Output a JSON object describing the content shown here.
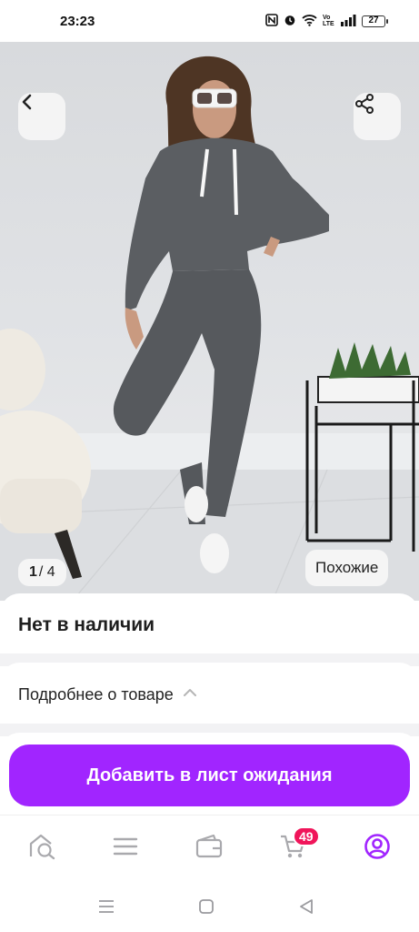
{
  "status_bar": {
    "time": "23:23",
    "icons": [
      "nfc-icon",
      "alarm-icon",
      "wifi-icon",
      "volte-icon",
      "signal-icon"
    ],
    "volte_label": "Vo LTE",
    "battery": "27"
  },
  "photo": {
    "counter_current": "1",
    "counter_total": "/ 4",
    "similar_label": "Похожие"
  },
  "product": {
    "stock_status": "Нет в наличии",
    "details_label": "Подробнее о товаре"
  },
  "action": {
    "wait_button": "Добавить в лист ожидания",
    "accent_color": "#a125ff"
  },
  "tabbar": {
    "items": [
      "home-search-icon",
      "catalog-icon",
      "wallet-icon",
      "cart-icon",
      "profile-icon"
    ],
    "cart_badge": "49",
    "active_color": "#a125ff",
    "badge_color": "#f0155a"
  },
  "navbar": {
    "items": [
      "menu-icon",
      "home-icon",
      "back-icon"
    ]
  }
}
